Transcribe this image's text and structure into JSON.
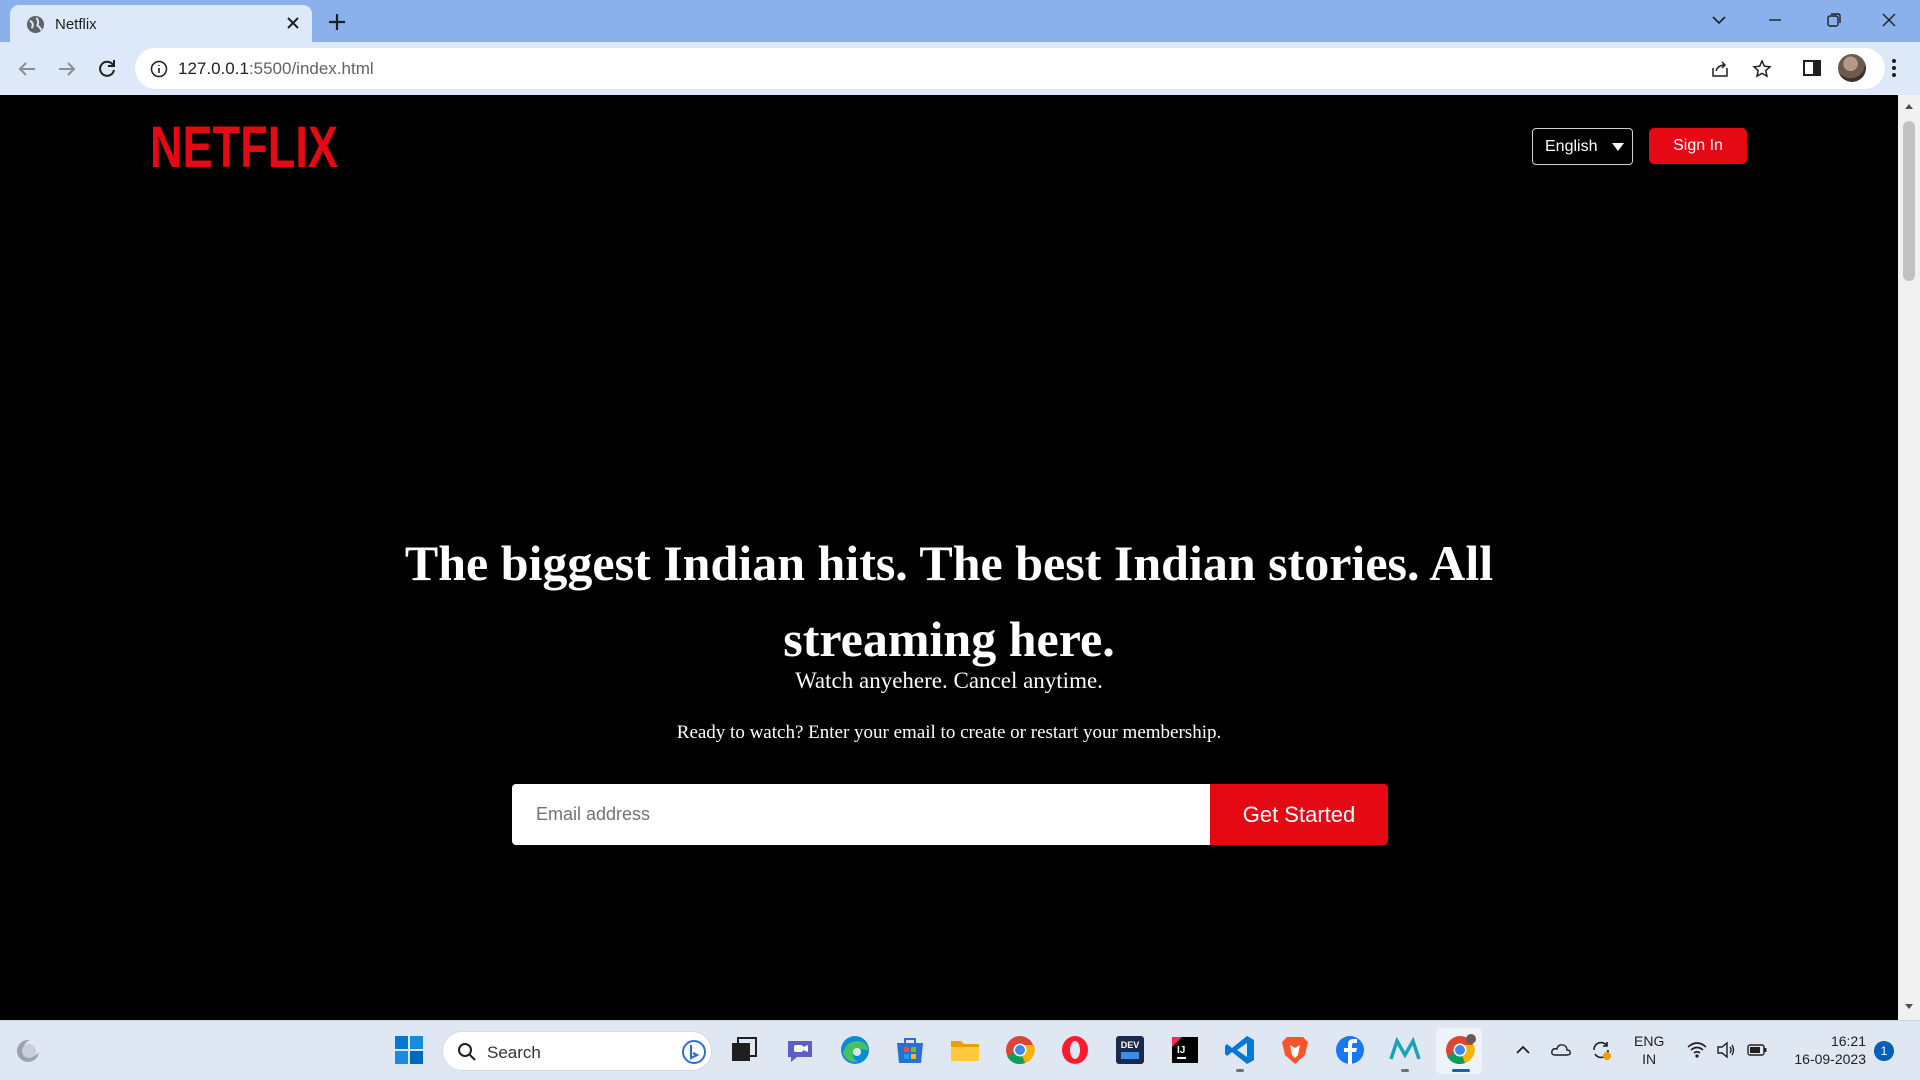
{
  "browser": {
    "tab_title": "Netflix",
    "url_host": "127.0.0.1",
    "url_path": ":5500/index.html"
  },
  "header": {
    "logo_text": "NETFLIX",
    "language_selected": "English",
    "signin_label": "Sign In"
  },
  "hero": {
    "title": "The biggest Indian hits. The best Indian stories. All streaming here.",
    "subtitle": "Watch anyehere. Cancel anytime.",
    "cta_text": "Ready to watch? Enter your email to create or restart your membership.",
    "email_placeholder": "Email address",
    "get_started_label": "Get Started"
  },
  "taskbar": {
    "search_label": "Search",
    "lang_line1": "ENG",
    "lang_line2": "IN",
    "time": "16:21",
    "date": "16-09-2023",
    "notification_count": "1"
  },
  "colors": {
    "brand_red": "#e50914",
    "page_bg": "#000000",
    "tab_strip": "#8ab1ec"
  }
}
